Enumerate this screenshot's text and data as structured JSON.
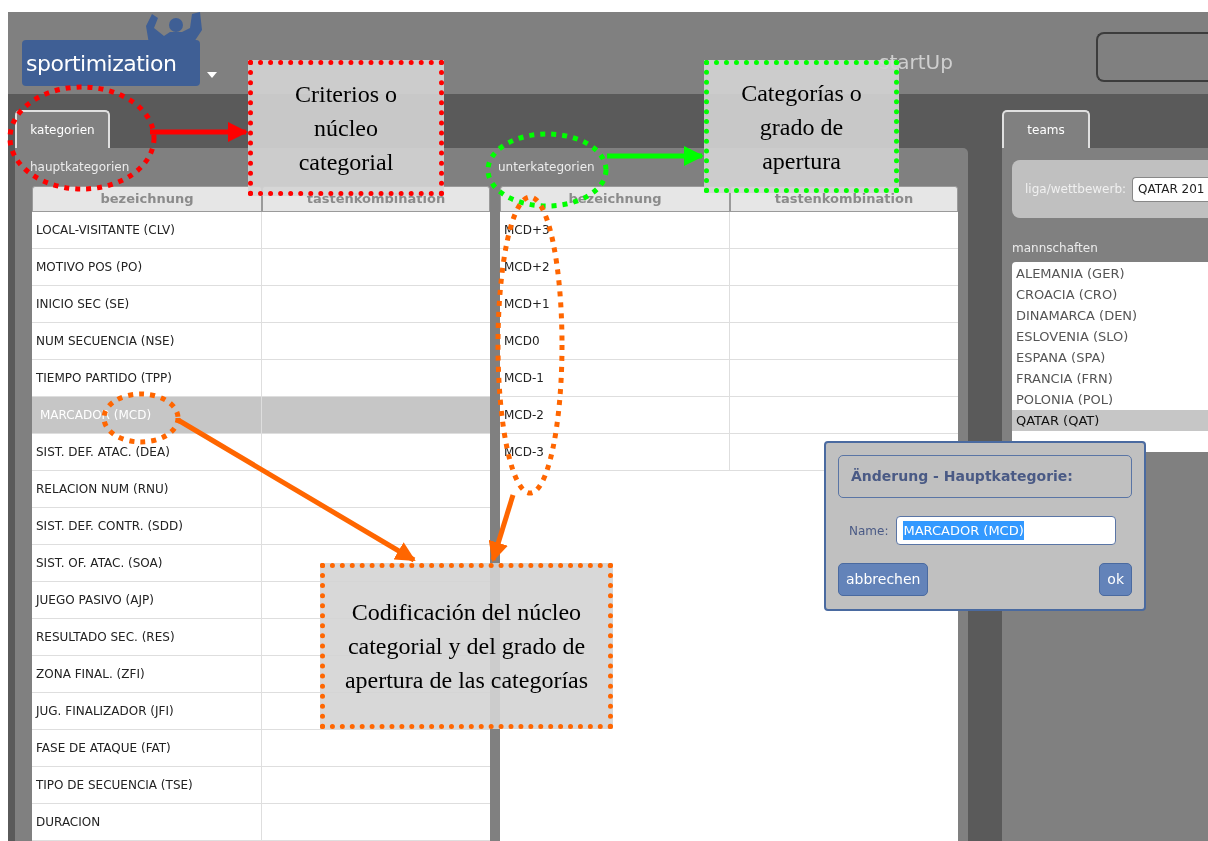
{
  "header": {
    "logo": "sportimization",
    "title": "startUp"
  },
  "left_tab": {
    "label": "kategorien",
    "selected": true
  },
  "main_categories": {
    "label": "hauptkategorien",
    "columns": [
      "bezeichnung",
      "tastenkombination"
    ],
    "rows": [
      {
        "name": "LOCAL-VISITANTE (CLV)",
        "selected": false
      },
      {
        "name": "MOTIVO POS (PO)",
        "selected": false
      },
      {
        "name": "INICIO SEC (SE)",
        "selected": false
      },
      {
        "name": "NUM SECUENCIA (NSE)",
        "selected": false
      },
      {
        "name": "TIEMPO PARTIDO (TPP)",
        "selected": false
      },
      {
        "name": "MARCADOR (MCD)",
        "selected": true
      },
      {
        "name": "SIST. DEF. ATAC. (DEA)",
        "selected": false
      },
      {
        "name": "RELACION NUM (RNU)",
        "selected": false
      },
      {
        "name": "SIST. DEF. CONTR. (SDD)",
        "selected": false
      },
      {
        "name": "SIST. OF. ATAC. (SOA)",
        "selected": false
      },
      {
        "name": "JUEGO PASIVO (AJP)",
        "selected": false
      },
      {
        "name": "RESULTADO SEC. (RES)",
        "selected": false
      },
      {
        "name": "ZONA FINAL. (ZFI)",
        "selected": false
      },
      {
        "name": "JUG. FINALIZADOR (JFI)",
        "selected": false
      },
      {
        "name": "FASE DE ATAQUE (FAT)",
        "selected": false
      },
      {
        "name": "TIPO DE SECUENCIA (TSE)",
        "selected": false
      },
      {
        "name": "DURACION",
        "selected": false
      }
    ]
  },
  "sub_categories": {
    "label": "unterkategorien",
    "columns": [
      "bezeichnung",
      "tastenkombination"
    ],
    "rows": [
      {
        "name": "MCD+3",
        "selected": false
      },
      {
        "name": "MCD+2",
        "selected": false
      },
      {
        "name": "MCD+1",
        "selected": false
      },
      {
        "name": "MCD0",
        "selected": false
      },
      {
        "name": "MCD-1",
        "selected": false
      },
      {
        "name": "MCD-2",
        "selected": false
      },
      {
        "name": "MCD-3",
        "selected": false
      }
    ]
  },
  "right_tab": {
    "label": "teams",
    "selected": true
  },
  "league": {
    "label": "liga/wettbewerb:",
    "value": "QATAR 201"
  },
  "teams": {
    "label": "mannschaften",
    "items": [
      {
        "name": "ALEMANIA (GER)",
        "selected": false
      },
      {
        "name": "CROACIA (CRO)",
        "selected": false
      },
      {
        "name": "DINAMARCA (DEN)",
        "selected": false
      },
      {
        "name": "ESLOVENIA (SLO)",
        "selected": false
      },
      {
        "name": "ESPANA (SPA)",
        "selected": false
      },
      {
        "name": "FRANCIA (FRN)",
        "selected": false
      },
      {
        "name": "POLONIA (POL)",
        "selected": false
      },
      {
        "name": "QATAR (QAT)",
        "selected": true
      }
    ]
  },
  "dialog": {
    "title": "Änderung - Hauptkategorie:",
    "name_label": "Name:",
    "name_value": "MARCADOR (MCD)",
    "text_selected": true,
    "buttons": [
      "abbrechen",
      "ok"
    ]
  },
  "annotations": [
    {
      "text": "Criterios o núcleo categorial",
      "color": "#ff0000"
    },
    {
      "text": "Categorías o grado de apertura",
      "color": "#00ff00"
    },
    {
      "text": "Codificación del núcleo categorial y del grado de apertura de las categorías",
      "color": "#ff6600"
    }
  ]
}
